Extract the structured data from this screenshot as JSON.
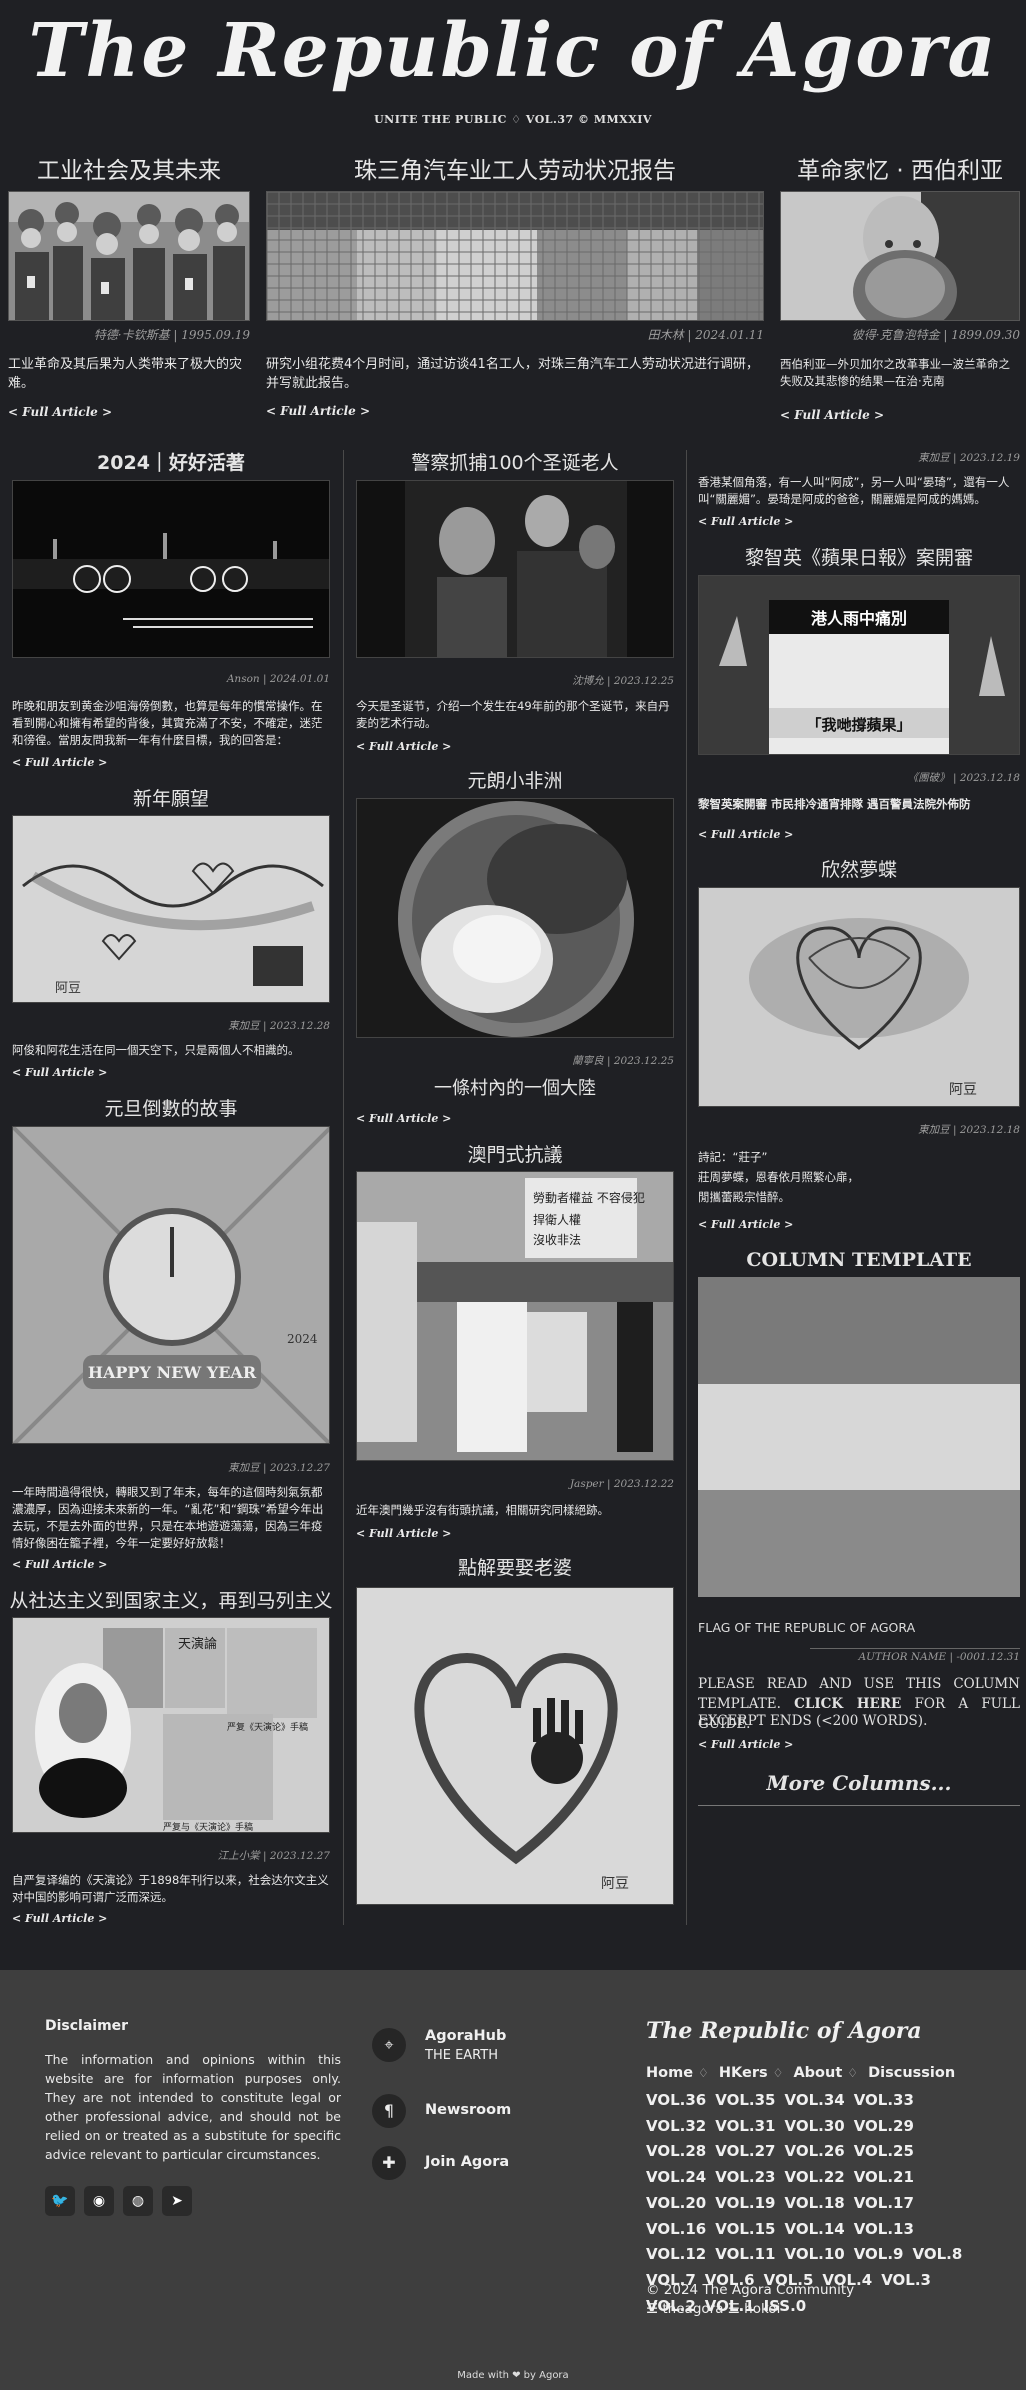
{
  "masthead": {
    "title": "The Republic of Agora",
    "subtitle": "UNITE THE PUBLIC ♢ VOL.37 © MMXXIV"
  },
  "top": [
    {
      "title": "工业社会及其未来",
      "byline": "特德·卡钦斯基 | 1995.09.19",
      "excerpt": "工业革命及其后果为人类带来了极大的灾难。",
      "more": "< Full Article >"
    },
    {
      "title": "珠三角汽车业工人劳动状况报告",
      "byline": "田木林 | 2024.01.11",
      "excerpt": "研究小组花费4个月时间，通过访谈41名工人，对珠三角汽车工人劳动状况进行调研，并写就此报告。",
      "more": "< Full Article >"
    },
    {
      "title": "革命家忆 · 西伯利亚",
      "byline": "彼得·克鲁泡特金 | 1899.09.30",
      "excerpt": "西伯利亚—外贝加尔之改革事业—波兰革命之失败及其悲惨的结果—在治·克南",
      "more": "< Full Article >"
    }
  ],
  "left": [
    {
      "title": "2024｜好好活著",
      "byline": "Anson | 2024.01.01",
      "excerpt": "昨晚和朋友到黄金沙咀海傍倒數，也算是每年的慣常操作。在看到開心和擁有希望的背後，其實充滿了不安，不確定，迷茫和徬徨。當朋友問我新一年有什麼目標，我的回答是：",
      "more": "< Full Article >"
    },
    {
      "title": "新年願望",
      "byline": "東加豆 | 2023.12.28",
      "excerpt": "阿俊和阿花生活在同一個天空下，只是兩個人不相識的。",
      "more": "< Full Article >"
    },
    {
      "title": "元旦倒數的故事",
      "byline": "東加豆 | 2023.12.27",
      "excerpt": "一年時間過得很快，轉眼又到了年末，每年的這個時刻氣氛都濃濃厚，因為迎接未來新的一年。“亂花”和“鋼珠”希望今年出去玩，不是去外面的世界，只是在本地遊遊蕩蕩，因為三年疫情好像困在籠子裡，今年一定要好好放鬆！",
      "more": "< Full Article >"
    },
    {
      "title": "从社达主义到国家主义，再到马列主义",
      "byline": "江上小棠 | 2023.12.27",
      "excerpt": "自严复译编的《天演论》于1898年刊行以来，社会达尔文主义对中国的影响可谓广泛而深远。",
      "more": "< Full Article >",
      "img_texts": {
        "a": "天演論",
        "b": "严复《天演论》手稿",
        "c": "严复与《天演论》手稿"
      }
    }
  ],
  "mid": [
    {
      "title": "警察抓捕100个圣诞老人",
      "byline": "沈博允 | 2023.12.25",
      "excerpt": "今天是圣诞节，介绍一个发生在49年前的那个圣诞节，来自丹麦的艺术行动。",
      "more": "< Full Article >"
    },
    {
      "title": "元朗小非洲",
      "byline": "蘭寧良 | 2023.12.25",
      "subtitle": "一條村內的一個大陸",
      "more": "< Full Article >"
    },
    {
      "title": "澳門式抗議",
      "byline": "Jasper | 2023.12.22",
      "excerpt": "近年澳門幾乎沒有街頭抗議，相關研究同樣絕跡。",
      "more": "< Full Article >",
      "img_texts": {
        "a": "勞動者權益 不容侵犯",
        "b": "捍衛人權",
        "c": "沒收非法"
      }
    },
    {
      "title": "點解要娶老婆",
      "img_sig": "阿豆"
    }
  ],
  "right": [
    {
      "byline": "東加豆 | 2023.12.19",
      "excerpt": "香港某個角落，有一人叫“阿成”，另一人叫“晏琦”，還有一人叫“關麗媚”。晏琦是阿成的爸爸，關麗媚是阿成的媽媽。",
      "more": "< Full Article >"
    },
    {
      "title": "黎智英《蘋果日報》案開審",
      "byline": "《團破》 | 2023.12.18",
      "excerpt": "黎智英案開審 市民排冷通宵排隊 遇百警員法院外佈防",
      "more": "< Full Article >",
      "img_texts": {
        "a": "港人雨中痛別",
        "b": "「我哋撐蘋果」"
      }
    },
    {
      "title": "欣然夢蝶",
      "byline": "東加豆 | 2023.12.18",
      "excerpt": "詩記：“莊子”\n莊周夢蝶，恩春依月照繁心扉，\n閒攜蕾殿宗惜醉。",
      "more": "< Full Article >",
      "img_sig": "阿豆"
    },
    {
      "title": "COLUMN TEMPLATE",
      "caption": "FLAG OF THE REPUBLIC OF AGORA",
      "byline": "AUTHOR NAME | -0001.12.31",
      "excerpt_a": "PLEASE READ AND USE THIS COLUMN TEMPLATE.",
      "excerpt_link": "CLICK HERE",
      "excerpt_b": "FOR A FULL GUIDE.",
      "excerpt_c": "EXCERPT ENDS (<200 WORDS).",
      "more": "< Full Article >",
      "more_columns": "More Columns...",
      "flag_colors": [
        "#7a7a7a",
        "#d7d7d7",
        "#8a8a8a"
      ]
    }
  ],
  "image_labels": {
    "clock_banner": "HAPPY NEW YEAR",
    "clock_tag": "2024",
    "newyear_sig": "阿豆"
  },
  "footer": {
    "disclaimer_title": "Disclaimer",
    "disclaimer_text": "The information and opinions within this website are for information purposes only. They are not intended to constitute legal or other professional advice, and should not be relied on or treated as a substitute for specific advice relevant to particular circumstances.",
    "social": [
      "twitter-icon",
      "github-icon",
      "reddit-icon",
      "telegram-icon"
    ],
    "links": [
      {
        "title": "AgoraHub",
        "sub": "THE EARTH",
        "icon": "location-pin-icon"
      },
      {
        "title": "Newsroom",
        "icon": "paragraph-icon"
      },
      {
        "title": "Join Agora",
        "icon": "puzzle-icon"
      }
    ],
    "brand": "The Republic of Agora",
    "nav": [
      "Home",
      "HKers",
      "About",
      "Discussion"
    ],
    "vols": [
      "VOL.36",
      "VOL.35",
      "VOL.34",
      "VOL.33",
      "VOL.32",
      "VOL.31",
      "VOL.30",
      "VOL.29",
      "VOL.28",
      "VOL.27",
      "VOL.26",
      "VOL.25",
      "VOL.24",
      "VOL.23",
      "VOL.22",
      "VOL.21",
      "VOL.20",
      "VOL.19",
      "VOL.18",
      "VOL.17",
      "VOL.16",
      "VOL.15",
      "VOL.14",
      "VOL.13",
      "VOL.12",
      "VOL.11",
      "VOL.10",
      "VOL.9",
      "VOL.8",
      "VOL.7",
      "VOL.6",
      "VOL.5",
      "VOL.4",
      "VOL.3",
      "VOL.2",
      "VOL.1",
      "ISS.0"
    ],
    "copyright": "© 2024 The Agora Community",
    "credits": "☰ theagora ☰ hokoi",
    "made_with": "Made with ❤ by Agora"
  }
}
